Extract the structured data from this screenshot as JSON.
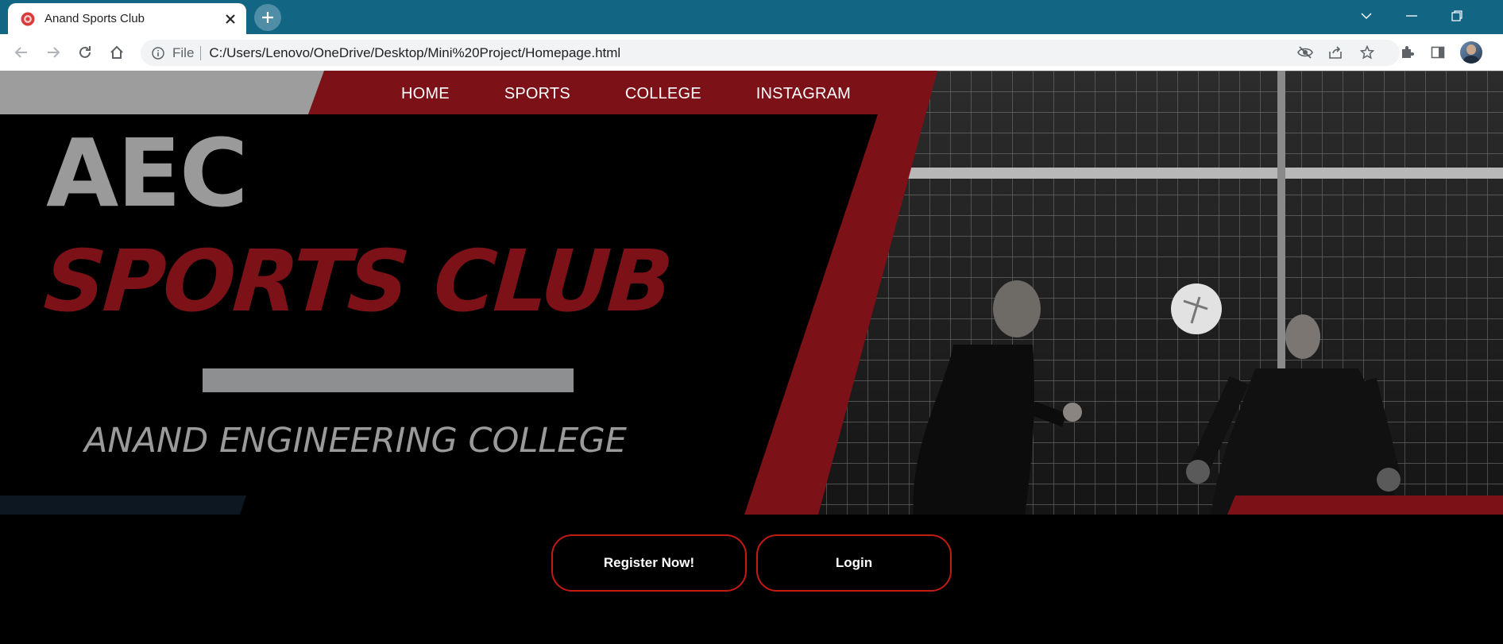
{
  "browser": {
    "tab_title": "Anand Sports Club",
    "file_label": "File",
    "url": "C:/Users/Lenovo/OneDrive/Desktop/Mini%20Project/Homepage.html"
  },
  "nav": {
    "items": [
      "HOME",
      "SPORTS",
      "COLLEGE",
      "INSTAGRAM"
    ]
  },
  "hero": {
    "line1": "AEC",
    "line2": "SPORTS CLUB",
    "line3": "ANAND ENGINEERING COLLEGE"
  },
  "actions": {
    "register": "Register Now!",
    "login": "Login"
  },
  "colors": {
    "accent_red": "#7d1118",
    "button_border": "#c41a14",
    "tabstrip": "#136584",
    "gray_text": "#9a9a9a"
  },
  "icons": [
    "favicon-icon",
    "close-icon",
    "plus-icon",
    "chevron-down-icon",
    "minimize-icon",
    "restore-icon",
    "back-icon",
    "forward-icon",
    "reload-icon",
    "home-icon",
    "info-icon",
    "eye-off-icon",
    "share-icon",
    "star-icon",
    "puzzle-icon",
    "sidepanel-icon",
    "avatar"
  ]
}
